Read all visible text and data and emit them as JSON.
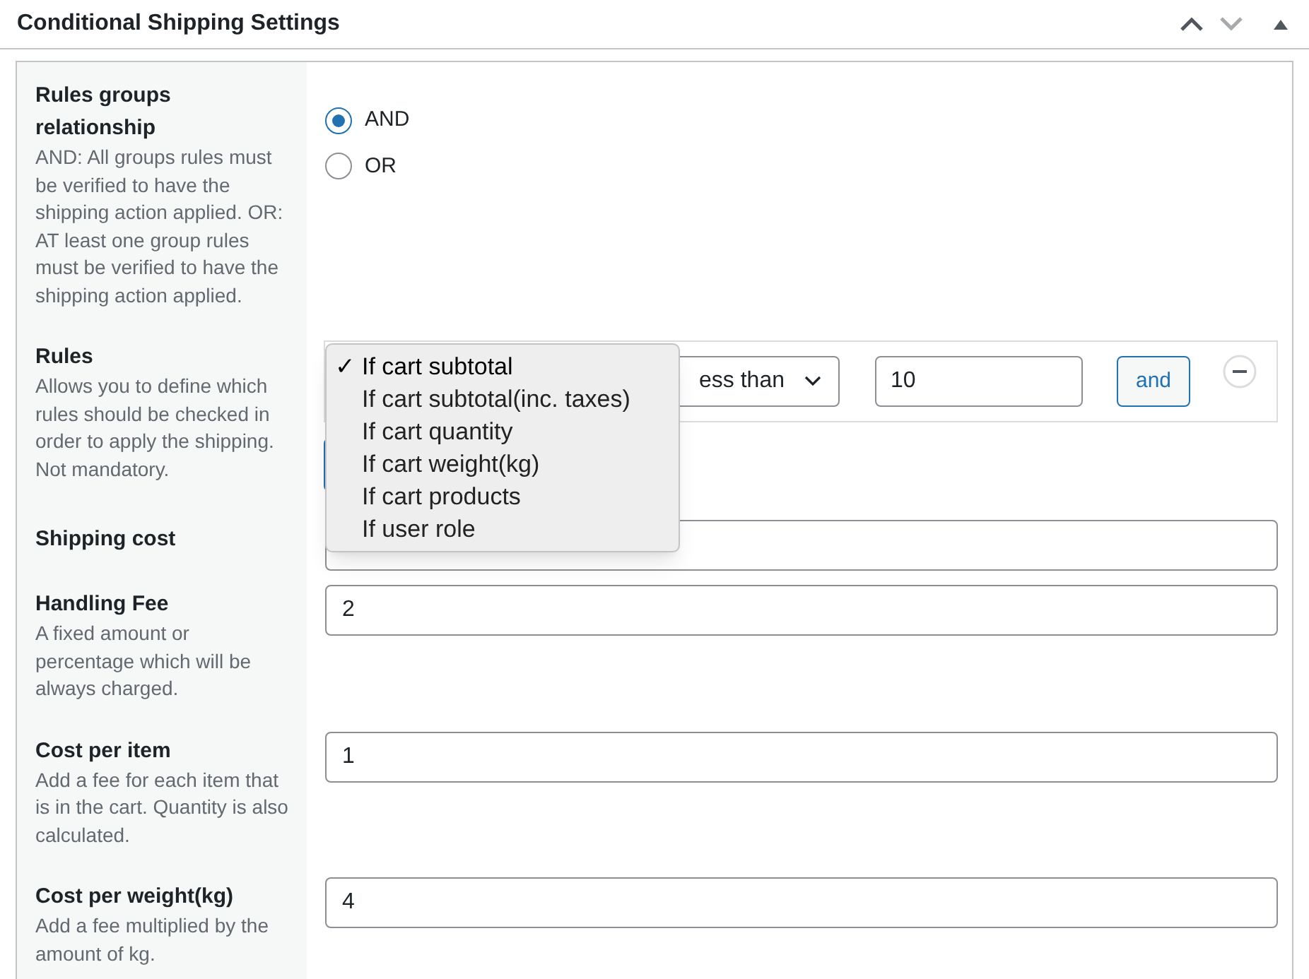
{
  "header": {
    "title": "Conditional Shipping Settings"
  },
  "relationship": {
    "label": "Rules groups relationship",
    "description": "AND: All groups rules must be verified to have the shipping action applied. OR: AT least one group rules must be verified to have the shipping action applied.",
    "options": [
      {
        "label": "AND",
        "selected": true
      },
      {
        "label": "OR",
        "selected": false
      }
    ]
  },
  "rules": {
    "label": "Rules",
    "description": "Allows you to define which rules should be checked in order to apply the shipping. Not mandatory.",
    "operator": "ess than",
    "value": "10",
    "and_button": "and",
    "dropdown": [
      {
        "label": "If cart subtotal",
        "selected": true,
        "check": "✓"
      },
      {
        "label": "If cart subtotal(inc. taxes)",
        "selected": false
      },
      {
        "label": "If cart quantity",
        "selected": false
      },
      {
        "label": "If cart weight(kg)",
        "selected": false
      },
      {
        "label": "If cart products",
        "selected": false
      },
      {
        "label": "If user role",
        "selected": false
      }
    ]
  },
  "fields": [
    {
      "label": "Shipping cost"
    },
    {
      "label": "Handling Fee",
      "description": "A fixed amount or percentage which will be always charged.",
      "value": "2"
    },
    {
      "label": "Cost per item",
      "description": "Add a fee for each item that is in the cart. Quantity is also calculated.",
      "value": "1"
    },
    {
      "label": "Cost per weight(kg)",
      "description": "Add a fee multiplied by the amount of kg.",
      "value": "4"
    }
  ]
}
